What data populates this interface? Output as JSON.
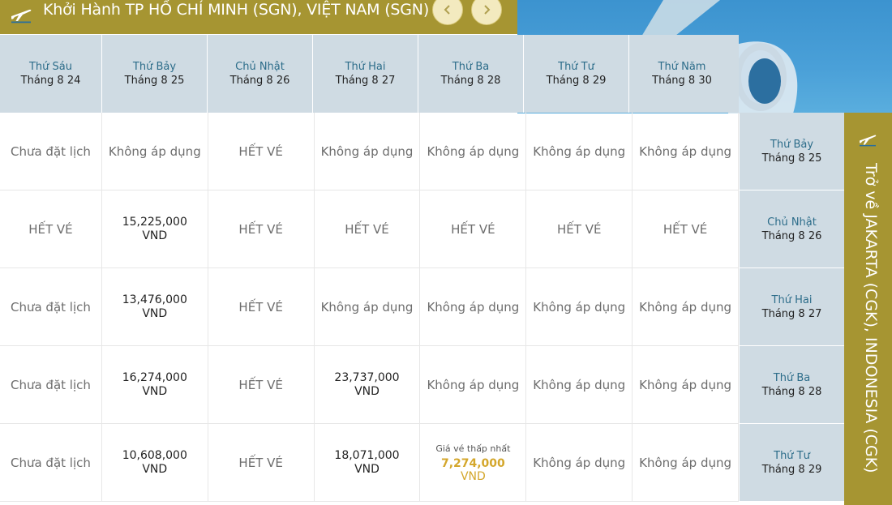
{
  "header": {
    "title": "Khởi Hành TP HỒ CHÍ MINH (SGN), VIỆT NAM (SGN)",
    "prev_icon": "chevron-left-icon",
    "next_icon": "chevron-right-icon",
    "plane_icon": "plane-takeoff-icon"
  },
  "departure_days": [
    {
      "day": "Thứ Sáu",
      "date": "Tháng 8 24"
    },
    {
      "day": "Thứ Bảy",
      "date": "Tháng 8 25"
    },
    {
      "day": "Chủ Nhật",
      "date": "Tháng 8 26"
    },
    {
      "day": "Thứ Hai",
      "date": "Tháng 8 27"
    },
    {
      "day": "Thứ Ba",
      "date": "Tháng 8 28"
    },
    {
      "day": "Thứ Tư",
      "date": "Tháng 8 29"
    },
    {
      "day": "Thứ Năm",
      "date": "Tháng 8 30"
    }
  ],
  "return_days": [
    {
      "day": "Thứ Bảy",
      "date": "Tháng 8 25"
    },
    {
      "day": "Chủ Nhật",
      "date": "Tháng 8 26"
    },
    {
      "day": "Thứ Hai",
      "date": "Tháng 8 27"
    },
    {
      "day": "Thứ Ba",
      "date": "Tháng 8 28"
    },
    {
      "day": "Thứ Tư",
      "date": "Tháng 8 29"
    }
  ],
  "return_label": "Trở về JAKARTA (CGK), INDONESIA (CGK)",
  "currency": "VND",
  "cheapest_label": "Giá vé thấp nhất",
  "grid": [
    [
      "Chưa đặt lịch",
      "Không áp dụng",
      "HẾT VÉ",
      "Không áp dụng",
      "Không áp dụng",
      "Không áp dụng",
      "Không áp dụng"
    ],
    [
      "HẾT VÉ",
      "15,225,000",
      "HẾT VÉ",
      "HẾT VÉ",
      "HẾT VÉ",
      "HẾT VÉ",
      "HẾT VÉ"
    ],
    [
      "Chưa đặt lịch",
      "13,476,000",
      "HẾT VÉ",
      "Không áp dụng",
      "Không áp dụng",
      "Không áp dụng",
      "Không áp dụng"
    ],
    [
      "Chưa đặt lịch",
      "16,274,000",
      "HẾT VÉ",
      "23,737,000",
      "Không áp dụng",
      "Không áp dụng",
      "Không áp dụng"
    ],
    [
      "Chưa đặt lịch",
      "10,608,000",
      "HẾT VÉ",
      "18,071,000",
      "7,274,000",
      "Không áp dụng",
      "Không áp dụng"
    ]
  ],
  "cheapest_cell": [
    4,
    4
  ],
  "colors": {
    "gold": "#a69532",
    "header_bg": "#cfdbe3",
    "day_text": "#2d6d8a",
    "cheapest": "#d4a72c"
  }
}
